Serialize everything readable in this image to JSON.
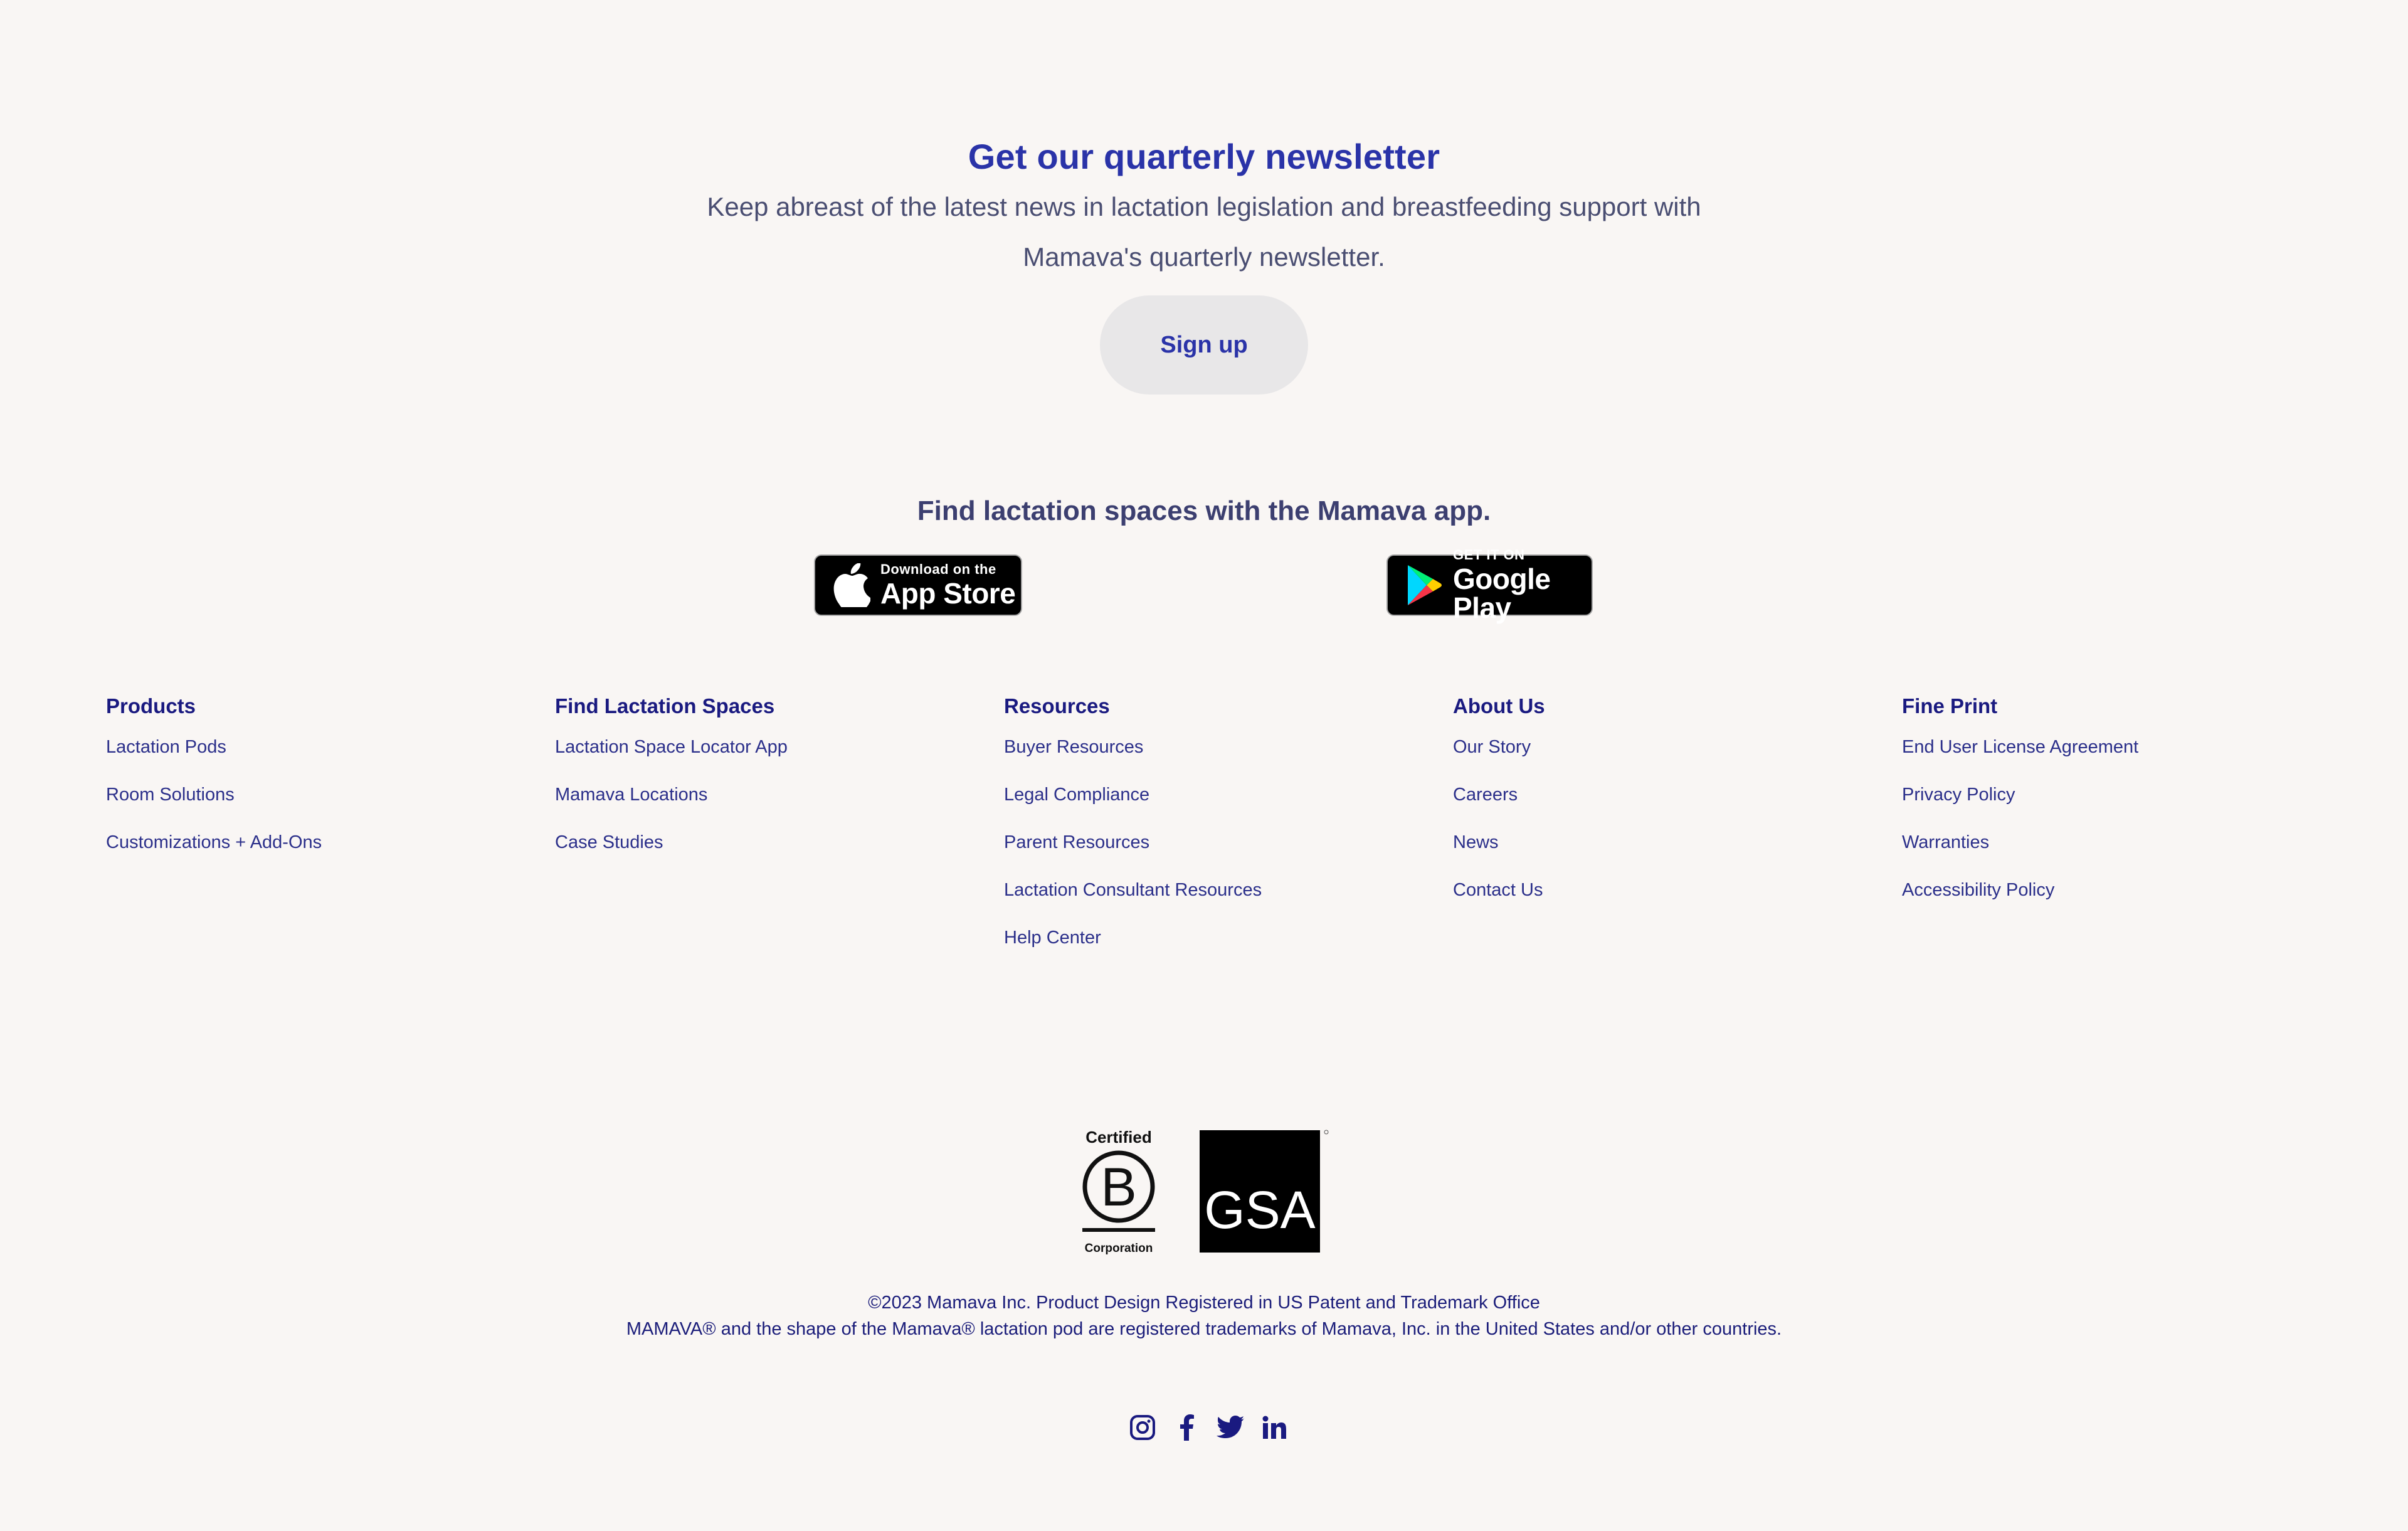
{
  "newsletter": {
    "title": "Get our quarterly newsletter",
    "description_line1": "Keep abreast of the latest news in lactation legislation and breastfeeding support with",
    "description_line2": "Mamava's quarterly newsletter.",
    "button_label": "Sign up"
  },
  "app_promo": {
    "title": "Find lactation spaces with the Mamava app.",
    "apple_badge": {
      "small_text": "Download on the",
      "big_text": "App Store",
      "icon": "apple-icon"
    },
    "google_badge": {
      "small_text": "GET IT ON",
      "big_text": "Google Play",
      "icon": "google-play-icon"
    }
  },
  "footer": {
    "columns": [
      {
        "heading": "Products",
        "links": [
          "Lactation Pods",
          "Room Solutions",
          "Customizations + Add-Ons"
        ]
      },
      {
        "heading": "Find Lactation Spaces",
        "links": [
          "Lactation Space Locator App",
          "Mamava Locations",
          "Case Studies"
        ]
      },
      {
        "heading": "Resources",
        "links": [
          "Buyer Resources",
          "Legal Compliance",
          "Parent Resources",
          "Lactation Consultant Resources",
          "Help Center"
        ]
      },
      {
        "heading": "About Us",
        "links": [
          "Our Story",
          "Careers",
          "News",
          "Contact Us"
        ]
      },
      {
        "heading": "Fine Print",
        "links": [
          "End User License Agreement",
          "Privacy Policy",
          "Warranties",
          "Accessibility Policy"
        ]
      }
    ]
  },
  "badges": {
    "bcorp": {
      "top": "Certified",
      "letter": "B",
      "bottom": "Corporation"
    },
    "gsa": {
      "text": "GSA"
    }
  },
  "legal": {
    "line1": "©2023 Mamava Inc. Product Design Registered in US Patent and Trademark Office",
    "line2": "MAMAVA® and the shape of the Mamava® lactation pod are registered trademarks of Mamava, Inc. in the United States and/or other countries."
  },
  "social": [
    "instagram-icon",
    "facebook-icon",
    "twitter-icon",
    "linkedin-icon"
  ],
  "colors": {
    "background": "#f9f6f4",
    "brand_blue": "#2a33a8",
    "navy": "#1a1a80",
    "button_bg": "#e8e7e8"
  }
}
